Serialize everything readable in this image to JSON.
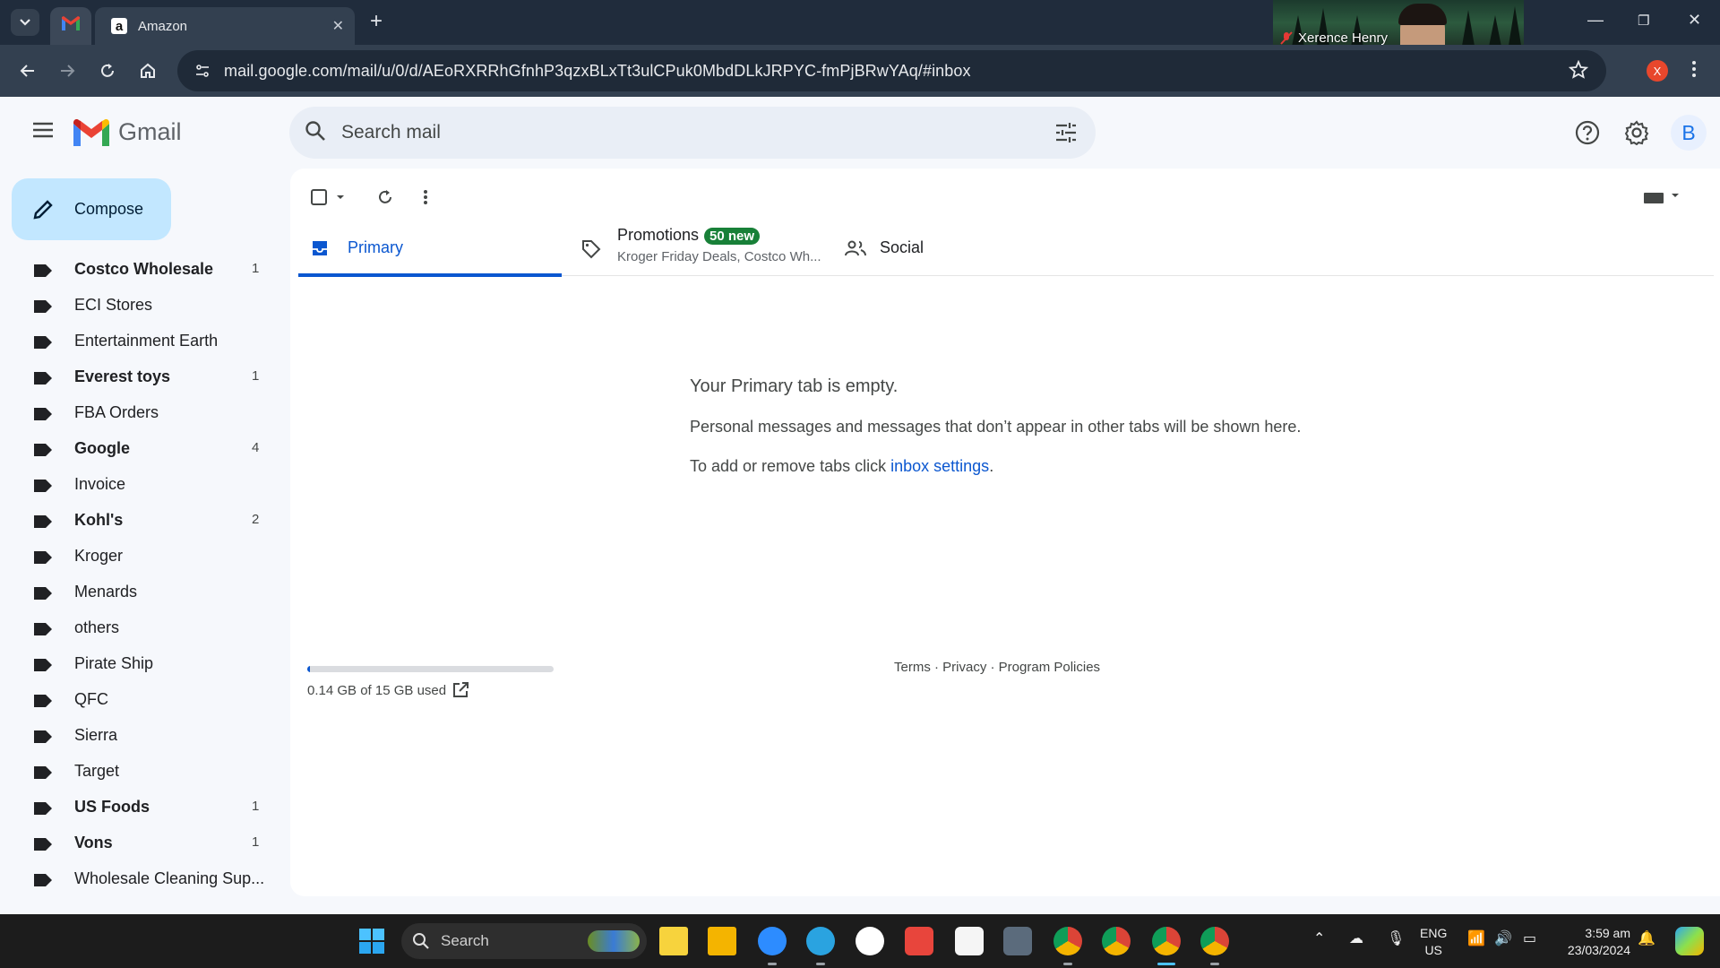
{
  "browser": {
    "tabs": [
      {
        "label": "",
        "icon": "gmail-icon",
        "active": true
      },
      {
        "label": "Amazon",
        "icon": "amazon-icon",
        "active": false
      }
    ],
    "url": "mail.google.com/mail/u/0/d/AEoRXRRhGfnhP3qzxBLxTt3ulCPuk0MbdDLkJRPYC-fmPjBRwYAq/#inbox",
    "profile_initial": "X"
  },
  "zoom_overlay": {
    "participant_name": "Xerence Henry"
  },
  "gmail": {
    "brand": "Gmail",
    "search_placeholder": "Search mail",
    "account_initial": "B",
    "compose_label": "Compose",
    "labels": [
      {
        "name": "Costco Wholesale",
        "count": "1",
        "bold": true
      },
      {
        "name": "ECI Stores",
        "count": "",
        "bold": false
      },
      {
        "name": "Entertainment Earth",
        "count": "",
        "bold": false
      },
      {
        "name": "Everest toys",
        "count": "1",
        "bold": true
      },
      {
        "name": "FBA Orders",
        "count": "",
        "bold": false
      },
      {
        "name": "Google",
        "count": "4",
        "bold": true
      },
      {
        "name": "Invoice",
        "count": "",
        "bold": false
      },
      {
        "name": "Kohl's",
        "count": "2",
        "bold": true
      },
      {
        "name": "Kroger",
        "count": "",
        "bold": false
      },
      {
        "name": "Menards",
        "count": "",
        "bold": false
      },
      {
        "name": "others",
        "count": "",
        "bold": false
      },
      {
        "name": "Pirate Ship",
        "count": "",
        "bold": false
      },
      {
        "name": "QFC",
        "count": "",
        "bold": false
      },
      {
        "name": "Sierra",
        "count": "",
        "bold": false
      },
      {
        "name": "Target",
        "count": "",
        "bold": false
      },
      {
        "name": "US Foods",
        "count": "1",
        "bold": true
      },
      {
        "name": "Vons",
        "count": "1",
        "bold": true
      },
      {
        "name": "Wholesale Cleaning Sup...",
        "count": "",
        "bold": false
      }
    ],
    "tabs": {
      "primary": "Primary",
      "promotions": "Promotions",
      "promotions_badge": "50 new",
      "promotions_snippet": "Kroger Friday Deals, Costco Wh...",
      "social": "Social"
    },
    "empty_state": {
      "title": "Your Primary tab is empty.",
      "line1": "Personal messages and messages that don’t appear in other tabs will be shown here.",
      "line2_prefix": "To add or remove tabs click ",
      "line2_link": "inbox settings",
      "line2_suffix": "."
    },
    "storage": {
      "text": "0.14 GB of 15 GB used",
      "used_fraction": 0.0093
    },
    "footer": "Terms · Privacy · Program Policies"
  },
  "taskbar": {
    "search_label": "Search",
    "language": "ENG",
    "region": "US",
    "time": "3:59 am",
    "date": "23/03/2024"
  },
  "colors": {
    "accent": "#0b57d0",
    "compose_bg": "#c2e7ff",
    "badge_green": "#188038",
    "chrome_frame": "#202c3c"
  }
}
